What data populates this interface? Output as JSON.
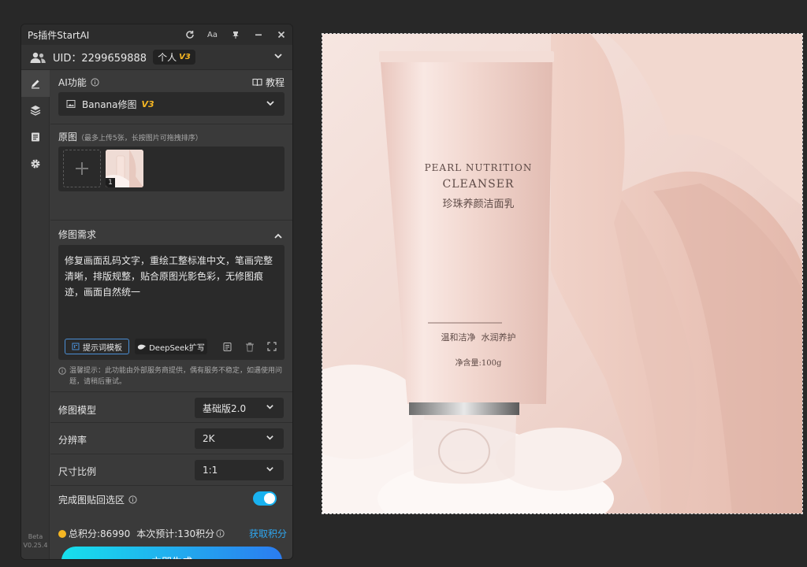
{
  "window": {
    "title": "Ps插件StartAI"
  },
  "titlebar_buttons": [
    "refresh-icon",
    "font-icon",
    "pin-icon",
    "minimize-icon",
    "close-icon"
  ],
  "font_button_label": "Aa",
  "user": {
    "uid_label": "UID：2299659888",
    "plan": "个人",
    "plan_badge": "V3"
  },
  "section_ai": {
    "label": "AI功能",
    "tutorial": "教程",
    "feature": "Banana修图",
    "feature_badge": "V3"
  },
  "source": {
    "label": "原图",
    "hint": "（最多上传5张，长按图片可拖拽排序）",
    "thumb_index": "1"
  },
  "requirement": {
    "label": "修图需求",
    "text": "修复画面乱码文字，重绘工整标准中文，笔画完整清晰，排版规整，贴合原图光影色彩，无修图痕迹，画面自然统一",
    "template_button": "提示词模板",
    "deepseek_button": "DeepSeek扩写"
  },
  "tip": "温馨提示：此功能由外部服务商提供，偶有服务不稳定，如遇使用问题，请稍后重试。",
  "model": {
    "label": "修图模型",
    "value": "基础版2.0"
  },
  "resolution": {
    "label": "分辨率",
    "value": "2K"
  },
  "ratio": {
    "label": "尺寸比例",
    "value": "1:1"
  },
  "paste_back": {
    "label": "完成图贴回选区",
    "enabled": true
  },
  "points": {
    "total": "总积分:86990",
    "estimate": "本次预计:130积分",
    "get": "获取积分"
  },
  "generate_button": "立即生成",
  "version": {
    "beta": "Beta",
    "number": "V0.25.4"
  },
  "product": {
    "line1": "PEARL NUTRITION",
    "line2": "CLEANSER",
    "cn_name": "珍珠养颜洁面乳",
    "tagline": "温和洁净  水润养护",
    "net": "净含量:100g"
  },
  "colors": {
    "accent": "#19b2f0",
    "badge": "#f5b623",
    "panel": "#3a3a3a"
  }
}
